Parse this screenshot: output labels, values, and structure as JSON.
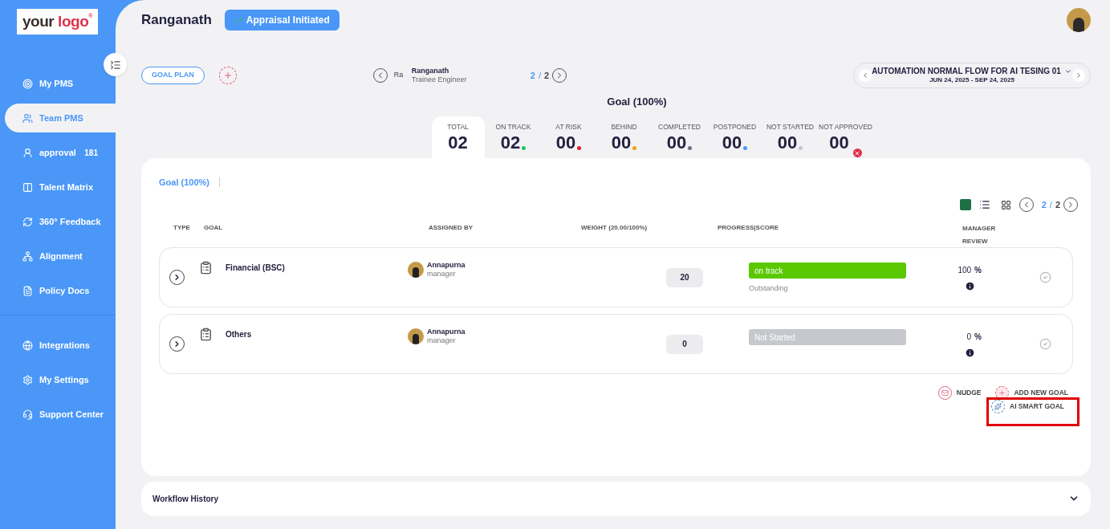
{
  "logo": {
    "first": "your",
    "second": "logo",
    "mark": "®"
  },
  "sidebar": {
    "items": [
      {
        "label": "My PMS",
        "selected": false
      },
      {
        "label": "Team PMS",
        "selected": true
      },
      {
        "label": "approval",
        "selected": false,
        "badge": "181"
      },
      {
        "label": "Talent Matrix",
        "selected": false
      },
      {
        "label": "360° Feedback",
        "selected": false
      },
      {
        "label": "Alignment",
        "selected": false
      },
      {
        "label": "Policy Docs",
        "selected": false
      }
    ],
    "bottom_items": [
      {
        "label": "Integrations",
        "selected": false
      },
      {
        "label": "My Settings",
        "selected": false
      },
      {
        "label": "Support Center",
        "selected": false
      }
    ]
  },
  "header": {
    "name": "Ranganath",
    "status_button": "Appraisal Initiated"
  },
  "goal_plan_button": "GOAL PLAN",
  "employee": {
    "name": "Ranganath",
    "role": "Trainee Engineer",
    "avatar_alt": "Ra",
    "page_current": "2",
    "page_sep": "/",
    "page_total": "2"
  },
  "cycle": {
    "title": "AUTOMATION NORMAL FLOW FOR AI TESING 01",
    "dates": "JUN 24, 2025 - SEP 24, 2025"
  },
  "summary_title": "Goal (100%)",
  "stats": [
    {
      "label": "TOTAL",
      "value": "02",
      "selected": true,
      "kind": "none"
    },
    {
      "label": "ON TRACK",
      "value": "02",
      "selected": false,
      "kind": "dot",
      "color": "#22c55e"
    },
    {
      "label": "AT RISK",
      "value": "00",
      "selected": false,
      "kind": "dot",
      "color": "#e11d2a"
    },
    {
      "label": "BEHIND",
      "value": "00",
      "selected": false,
      "kind": "dot",
      "color": "#f59e0b"
    },
    {
      "label": "COMPLETED",
      "value": "00",
      "selected": false,
      "kind": "dot",
      "color": "#6b7280"
    },
    {
      "label": "POSTPONED",
      "value": "00",
      "selected": false,
      "kind": "dot",
      "color": "#4a97f8"
    },
    {
      "label": "NOT STARTED",
      "value": "00",
      "selected": false,
      "kind": "dot",
      "color": "#c4c6cc"
    },
    {
      "label": "NOT APPROVED",
      "value": "00",
      "selected": false,
      "kind": "cross",
      "color": "#e0314b"
    }
  ],
  "goal_tab": "Goal (100%)",
  "table_pager": {
    "current": "2",
    "sep": "/",
    "total": "2"
  },
  "table": {
    "columns": [
      "TYPE",
      "GOAL",
      "ASSIGNED BY",
      "WEIGHT (20.00/100%)",
      "PROGRESS|SCORE",
      "MANAGER REVIEW"
    ],
    "rows": [
      {
        "goal": "Financial (BSC)",
        "assignee": "Annapurna",
        "assignee_role": "manager",
        "weight": "20",
        "status": "on track",
        "color": "#5ac800",
        "score": "Outstanding",
        "percent": "100",
        "percent_sign": "%"
      },
      {
        "goal": "Others",
        "assignee": "Annapurna",
        "assignee_role": "manager",
        "weight": "0",
        "status": "Not Started",
        "color": "#c6c8cd",
        "percent": "0",
        "percent_sign": "%"
      }
    ]
  },
  "actions": [
    {
      "label": "NUDGE",
      "kind": "nudge"
    },
    {
      "label": "ADD NEW GOAL",
      "kind": "add"
    },
    {
      "label": "AI SMART GOAL",
      "kind": "ai",
      "highlighted": true
    }
  ],
  "workflow_history": {
    "title": "Workflow History",
    "expanded": false
  }
}
